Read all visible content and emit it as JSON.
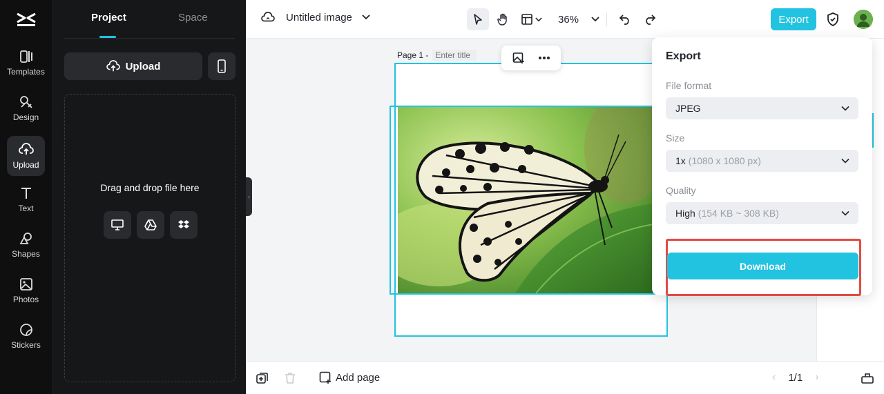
{
  "rail": {
    "items": [
      {
        "label": "Templates",
        "icon": "templates-icon"
      },
      {
        "label": "Design",
        "icon": "design-icon"
      },
      {
        "label": "Upload",
        "icon": "upload-icon"
      },
      {
        "label": "Text",
        "icon": "text-icon"
      },
      {
        "label": "Shapes",
        "icon": "shapes-icon"
      },
      {
        "label": "Photos",
        "icon": "photos-icon"
      },
      {
        "label": "Stickers",
        "icon": "stickers-icon"
      }
    ]
  },
  "panel": {
    "tabs": [
      {
        "label": "Project"
      },
      {
        "label": "Space"
      }
    ],
    "upload_label": "Upload",
    "dropzone_text": "Drag and drop file here"
  },
  "topbar": {
    "doc_title": "Untitled image",
    "zoom": "36%",
    "export_label": "Export"
  },
  "canvas": {
    "page_label": "Page 1 -",
    "page_title_placeholder": "Enter title"
  },
  "bottombar": {
    "add_page_label": "Add page",
    "page_counter": "1/1"
  },
  "export_panel": {
    "title": "Export",
    "file_format_label": "File format",
    "file_format_value": "JPEG",
    "size_label": "Size",
    "size_value": "1x",
    "size_detail": "(1080 x 1080 px)",
    "quality_label": "Quality",
    "quality_value": "High",
    "quality_detail": "(154 KB ~ 308 KB)",
    "download_label": "Download"
  },
  "colors": {
    "accent": "#22c3e0",
    "highlight": "#e24b43",
    "rail_bg": "#0f0f10",
    "panel_bg": "#161718"
  }
}
